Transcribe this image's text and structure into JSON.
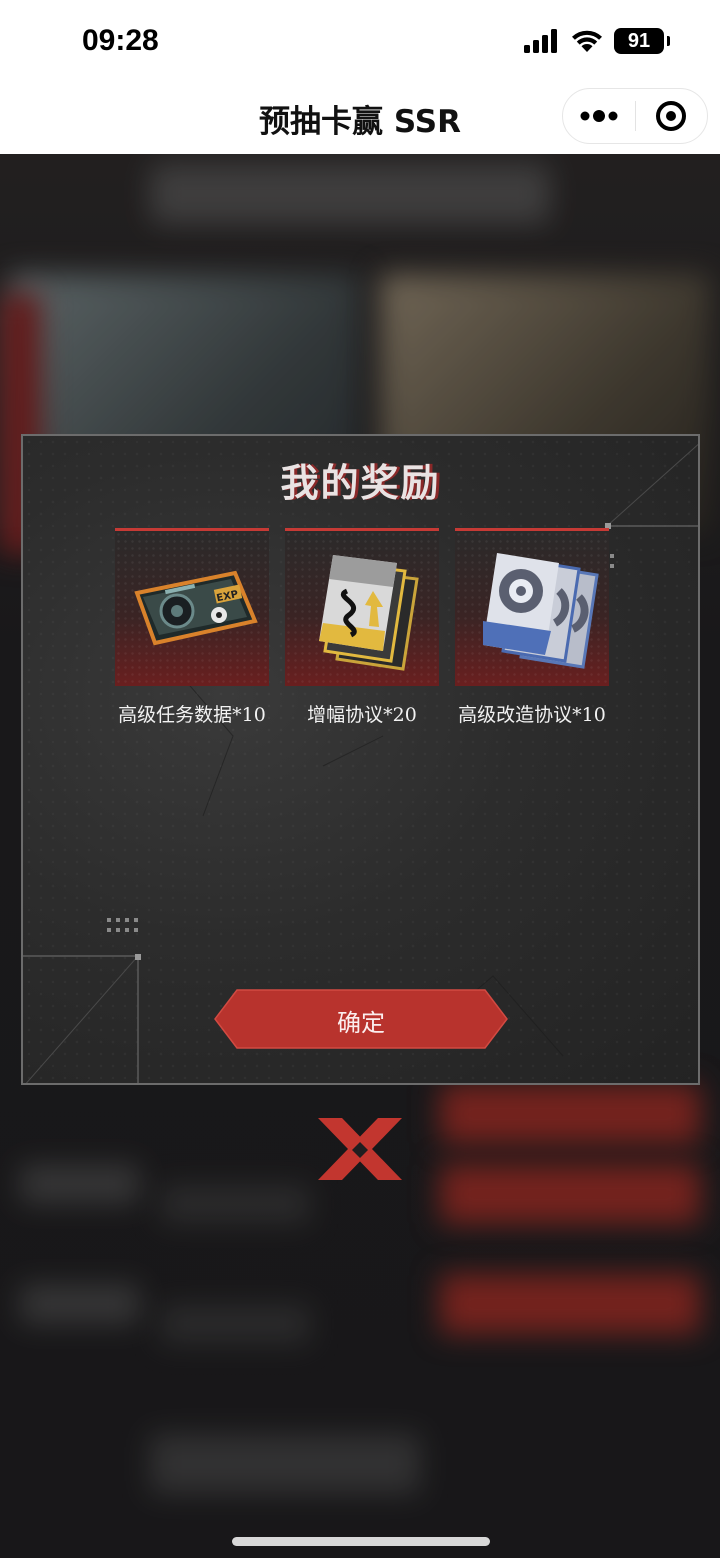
{
  "status_bar": {
    "time": "09:28",
    "battery": "91"
  },
  "nav": {
    "title": "预抽卡赢 SSR"
  },
  "modal": {
    "title": "我的奖励",
    "rewards": [
      {
        "label": "高级任务数据*10",
        "icon": "exp-data-card-icon"
      },
      {
        "label": "增幅协议*20",
        "icon": "increase-agreement-icon"
      },
      {
        "label": "高级改造协议*10",
        "icon": "transform-protocol-icon"
      }
    ],
    "confirm_label": "确定"
  },
  "colors": {
    "accent_red": "#c03a33",
    "modal_bg": "#2c2c2c",
    "text_light": "#f2f2f2"
  },
  "icons": {
    "signal": "signal-bars-icon",
    "wifi": "wifi-icon",
    "battery": "battery-icon",
    "more": "more-dots-icon",
    "target": "target-icon",
    "close": "close-x-icon"
  }
}
